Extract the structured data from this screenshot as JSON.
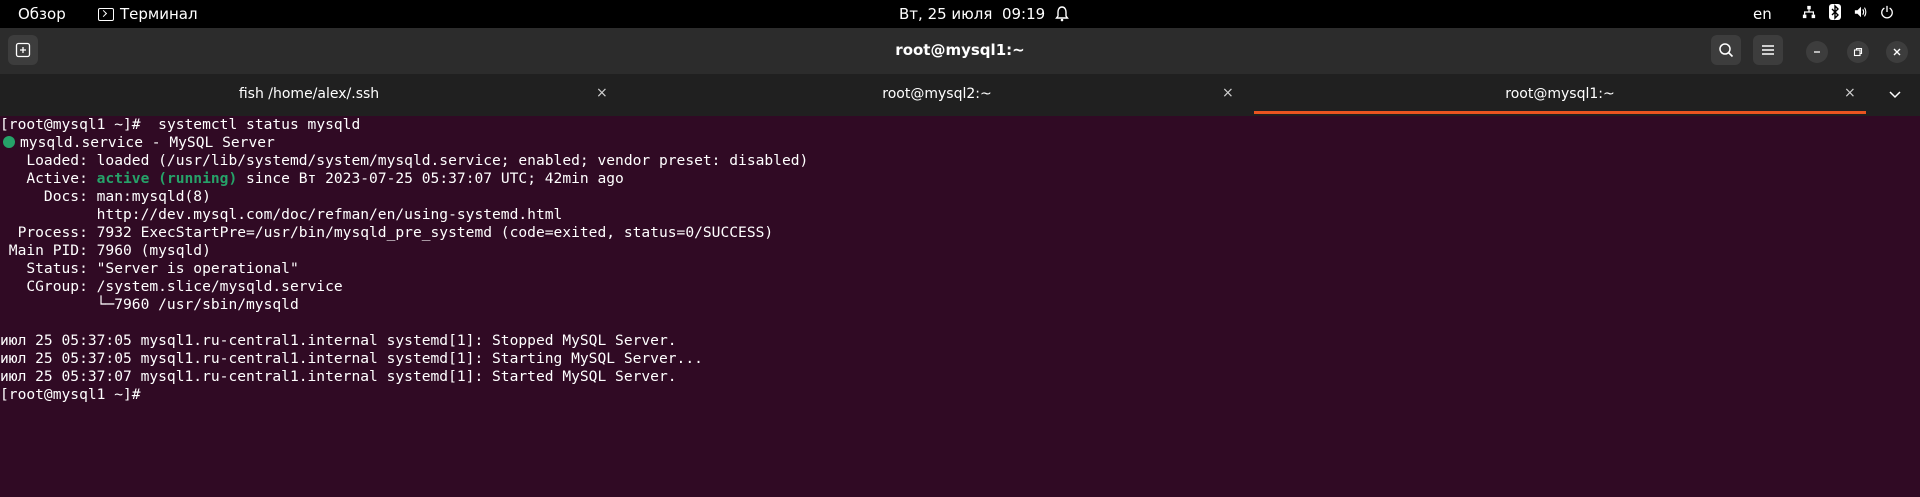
{
  "topbar": {
    "overview": "Обзор",
    "app_name": "Терминал",
    "datetime": "Вт, 25 июля  09:19",
    "language": "en",
    "icons": [
      "network-icon",
      "bluetooth-icon",
      "volume-icon",
      "power-icon"
    ]
  },
  "header": {
    "title": "root@mysql1:~",
    "buttons": [
      "new-tab-icon",
      "search-icon",
      "menu-icon",
      "minimize-icon",
      "maximize-icon",
      "close-icon"
    ]
  },
  "tabs": [
    {
      "label": "fish /home/alex/.ssh",
      "close": "×"
    },
    {
      "label": "root@mysql2:~",
      "close": "×"
    },
    {
      "label": "root@mysql1:~",
      "close": "×",
      "active": true
    }
  ],
  "colors": {
    "accent": "#e95420",
    "terminal_bg": "#300a24",
    "status_green": "#26a269"
  },
  "terminal": {
    "l1_prompt": "[root@mysql1 ~]#",
    "l1_cmd": "  systemctl status mysqld",
    "l2": "mysqld.service - MySQL Server",
    "l3": "   Loaded: loaded (/usr/lib/systemd/system/mysqld.service; enabled; vendor preset: disabled)",
    "l4_pre": "   Active: ",
    "l4_status": "active (running)",
    "l4_post": " since Вт 2023-07-25 05:37:07 UTC; 42min ago",
    "l5": "     Docs: man:mysqld(8)",
    "l6": "           http://dev.mysql.com/doc/refman/en/using-systemd.html",
    "l7": "  Process: 7932 ExecStartPre=/usr/bin/mysqld_pre_systemd (code=exited, status=0/SUCCESS)",
    "l8": " Main PID: 7960 (mysqld)",
    "l9": "   Status: \"Server is operational\"",
    "l10": "   CGroup: /system.slice/mysqld.service",
    "l11": "           └─7960 /usr/sbin/mysqld",
    "l13": "июл 25 05:37:05 mysql1.ru-central1.internal systemd[1]: Stopped MySQL Server.",
    "l14": "июл 25 05:37:05 mysql1.ru-central1.internal systemd[1]: Starting MySQL Server...",
    "l15": "июл 25 05:37:07 mysql1.ru-central1.internal systemd[1]: Started MySQL Server.",
    "l16": "[root@mysql1 ~]#"
  }
}
